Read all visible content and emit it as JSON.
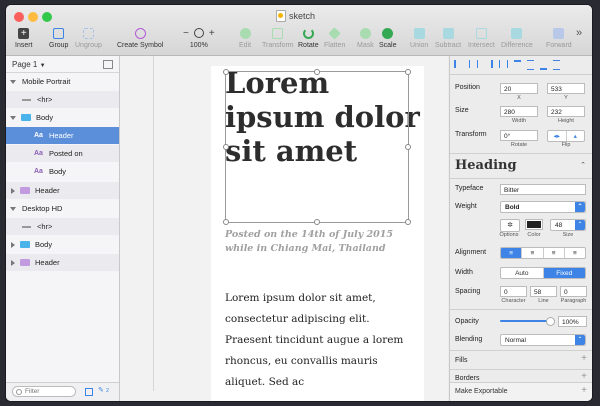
{
  "window": {
    "title": "sketch"
  },
  "toolbar": {
    "insert": "Insert",
    "group": "Group",
    "ungroup": "Ungroup",
    "create_symbol": "Create Symbol",
    "zoom": "100%",
    "edit": "Edit",
    "transform": "Transform",
    "rotate": "Rotate",
    "flatten": "Flatten",
    "mask": "Mask",
    "scale": "Scale",
    "union": "Union",
    "subtract": "Subtract",
    "intersect": "Intersect",
    "difference": "Difference",
    "forward": "Forward",
    "minus": "−",
    "plus": "+",
    "more": "»"
  },
  "layers": {
    "page": "Page 1",
    "items": [
      {
        "label": "Mobile Portrait"
      },
      {
        "label": "<hr>"
      },
      {
        "label": "Body"
      },
      {
        "label": "Header"
      },
      {
        "label": "Posted on"
      },
      {
        "label": "Body"
      },
      {
        "label": "Header"
      },
      {
        "label": "Desktop HD"
      },
      {
        "label": "<hr>"
      },
      {
        "label": "Body"
      },
      {
        "label": "Header"
      }
    ],
    "filter_placeholder": "Filter",
    "count": "2"
  },
  "canvas": {
    "heading": "Lorem ipsum dolor sit amet",
    "posted": "Posted on the 14th of July 2015 while in Chiang Mai, Thailand",
    "body": "Lorem ipsum dolor sit amet, consectetur adipiscing elit. Praesent tincidunt augue a lorem rhoncus, eu convallis mauris aliquet. Sed ac"
  },
  "inspector": {
    "position_label": "Position",
    "x": "20",
    "y": "533",
    "x_label": "X",
    "y_label": "Y",
    "size_label": "Size",
    "width": "280",
    "height": "232",
    "width_label": "Width",
    "height_label": "Height",
    "transform_label": "Transform",
    "rotate_value": "0°",
    "rotate_label": "Rotate",
    "flip_label": "Flip",
    "style_name": "Heading",
    "typeface_label": "Typeface",
    "typeface": "Bitter",
    "weight_label": "Weight",
    "weight": "Bold",
    "options_label": "Options",
    "color_label": "Color",
    "size_label2": "Size",
    "font_size": "48",
    "alignment_label": "Alignment",
    "width_label2": "Width",
    "auto": "Auto",
    "fixed": "Fixed",
    "spacing_label": "Spacing",
    "character": "0",
    "line": "58",
    "paragraph": "0",
    "character_label": "Character",
    "line_label": "Line",
    "paragraph_label": "Paragraph",
    "opacity_label": "Opacity",
    "opacity": "100%",
    "opacity_value": 1.0,
    "blending_label": "Blending",
    "blending": "Normal",
    "fills": "Fills",
    "borders": "Borders",
    "make_exportable": "Make Exportable"
  },
  "colors": {
    "accent": "#3d84e6",
    "selection": "#5b8fd9",
    "close": "#fc605c",
    "minimize": "#fdbc40",
    "zoom": "#34c84a"
  }
}
